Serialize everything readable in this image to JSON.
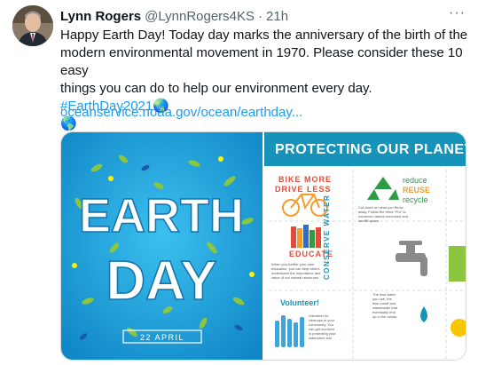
{
  "tweet": {
    "author_name": "Lynn Rogers",
    "handle": "@LynnRogers4KS",
    "separator": "·",
    "time": "21h",
    "more_icon": "more-horizontal-icon",
    "text_line1": "Happy Earth Day! Today day marks the anniversary of the birth of the",
    "text_line2": "modern environmental movement in 1970. Please consider these 10 easy",
    "text_line3": "things you can do to help our environment every day.",
    "hashtag": "#EarthDay2021",
    "emoji": "🌏",
    "emoji2": "🌎",
    "link": "oceanservice.noaa.gov/ocean/earthday..."
  },
  "media": {
    "left": {
      "word1": "EARTH",
      "word2": "DAY",
      "date": "22 APRIL"
    },
    "right": {
      "title": "PROTECTING OUR PLANET ST",
      "bike_line1": "BIKE MORE",
      "bike_line2": "DRIVE LESS",
      "reduce": "reduce",
      "reuse": "REUSE",
      "recycle": "recycle",
      "recycle_desc1": "Cut down on what you throw",
      "recycle_desc2": "away. Follow the three \"R's\" to",
      "recycle_desc3": "conserve natural resources and",
      "recycle_desc4": "landfill space.",
      "educate": "EDUCATE",
      "educate_desc1": "When you further your own",
      "educate_desc2": "education, you can help others",
      "educate_desc3": "understand the importance and",
      "educate_desc4": "value of our natural resources.",
      "conserve_water": "CONSERVE WATER",
      "water_desc1": "The less water",
      "water_desc2": "you use, the",
      "water_desc3": "less runoff and",
      "water_desc4": "wastewater that",
      "water_desc5": "eventually end",
      "water_desc6": "up in the ocean.",
      "volunteer": "Volunteer!",
      "volunteer_desc1": "Volunteer for",
      "volunteer_desc2": "cleanups in your",
      "volunteer_desc3": "community. You",
      "volunteer_desc4": "can get involved",
      "volunteer_desc5": "in protecting your",
      "volunteer_desc6": "watershed too!"
    }
  },
  "colors": {
    "link": "#1d9bf0",
    "muted": "#536471",
    "sky": "#1aa3d8",
    "band": "#1693b9"
  }
}
